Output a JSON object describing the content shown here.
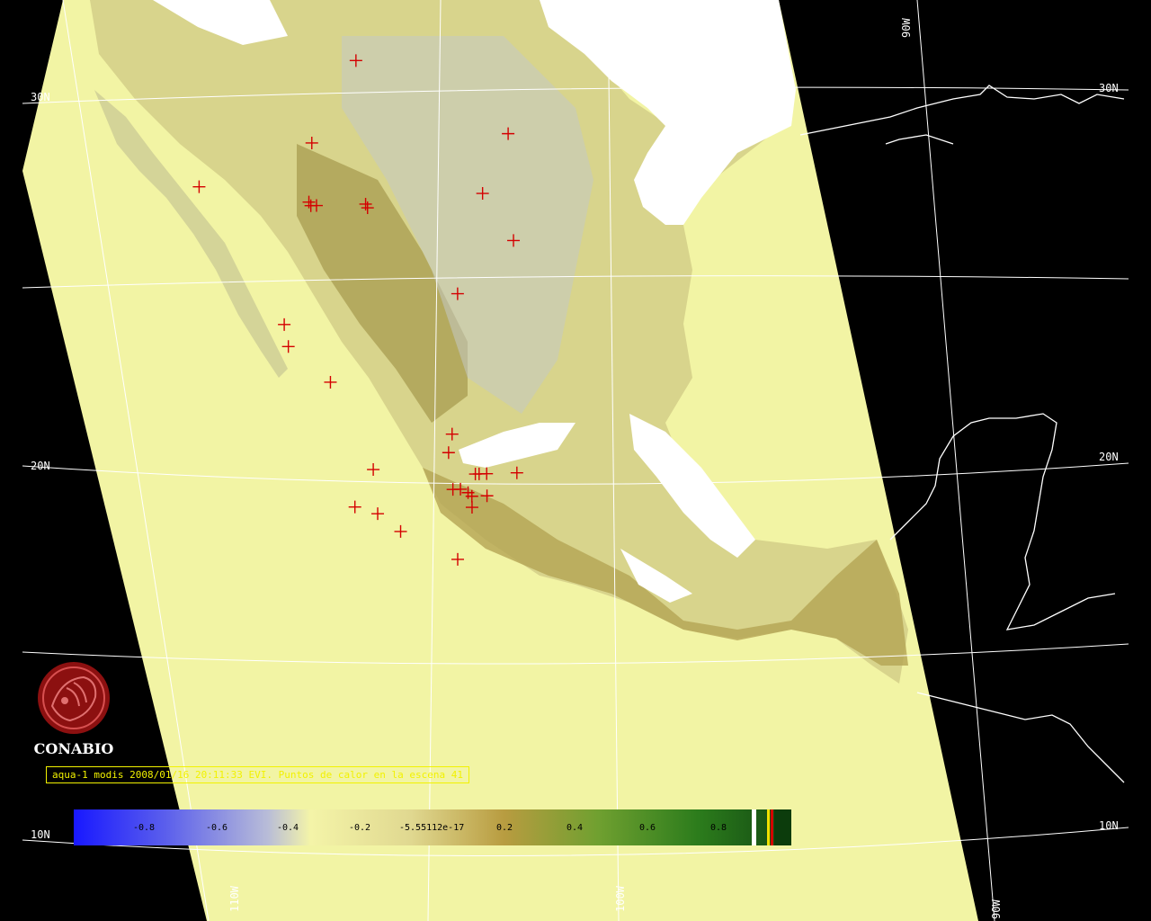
{
  "logo": {
    "name": "CONABIO"
  },
  "caption": {
    "text": "aqua-1 modis 2008/01/16 20:11:33 EVI. Puntos de calor en la escena 41"
  },
  "graticule": {
    "lat_labels": [
      "30N",
      "30N",
      "20N",
      "20N",
      "10N",
      "10N"
    ],
    "lon_labels": [
      "90W",
      "110W",
      "100W",
      "90W"
    ]
  },
  "legend": {
    "ticks": [
      "-0.8",
      "-0.6",
      "-0.4",
      "-0.2",
      "-5.55112e-17",
      "0.2",
      "0.4",
      "0.6",
      "0.8"
    ],
    "colors": {
      "low": "#2020ff",
      "mid_low": "#b0b8d8",
      "neutral": "#f4f4a8",
      "mid_high": "#b8a040",
      "high": "#1c5c1c"
    }
  },
  "colors": {
    "swath": "#f4f4a8",
    "land_low": "#c8c890",
    "land_high": "#8c8c3c",
    "cloud": "#ffffff",
    "hotspot": "#d40000"
  },
  "hotspots": [
    {
      "lon": -106.6,
      "lat": 31.6
    },
    {
      "lon": -107.8,
      "lat": 29.4
    },
    {
      "lon": -110.8,
      "lat": 28.3
    },
    {
      "lon": -107.9,
      "lat": 27.8
    },
    {
      "lon": -107.85,
      "lat": 27.7
    },
    {
      "lon": -107.7,
      "lat": 27.7
    },
    {
      "lon": -106.4,
      "lat": 27.7
    },
    {
      "lon": -106.35,
      "lat": 27.6
    },
    {
      "lon": -102.6,
      "lat": 29.5
    },
    {
      "lon": -103.3,
      "lat": 27.9
    },
    {
      "lon": -102.5,
      "lat": 26.6
    },
    {
      "lon": -104.0,
      "lat": 25.2
    },
    {
      "lon": -108.6,
      "lat": 24.5
    },
    {
      "lon": -108.5,
      "lat": 23.9
    },
    {
      "lon": -107.4,
      "lat": 22.9
    },
    {
      "lon": -104.2,
      "lat": 21.4
    },
    {
      "lon": -104.3,
      "lat": 20.9
    },
    {
      "lon": -106.3,
      "lat": 20.5
    },
    {
      "lon": -103.6,
      "lat": 20.3
    },
    {
      "lon": -103.5,
      "lat": 20.3
    },
    {
      "lon": -103.3,
      "lat": 20.3
    },
    {
      "lon": -102.5,
      "lat": 20.3
    },
    {
      "lon": -104.2,
      "lat": 19.9
    },
    {
      "lon": -104.0,
      "lat": 19.9
    },
    {
      "lon": -103.8,
      "lat": 19.8
    },
    {
      "lon": -103.7,
      "lat": 19.7
    },
    {
      "lon": -103.3,
      "lat": 19.7
    },
    {
      "lon": -106.8,
      "lat": 19.5
    },
    {
      "lon": -106.2,
      "lat": 19.3
    },
    {
      "lon": -103.7,
      "lat": 19.4
    },
    {
      "lon": -105.6,
      "lat": 18.8
    },
    {
      "lon": -104.1,
      "lat": 18.0
    }
  ]
}
